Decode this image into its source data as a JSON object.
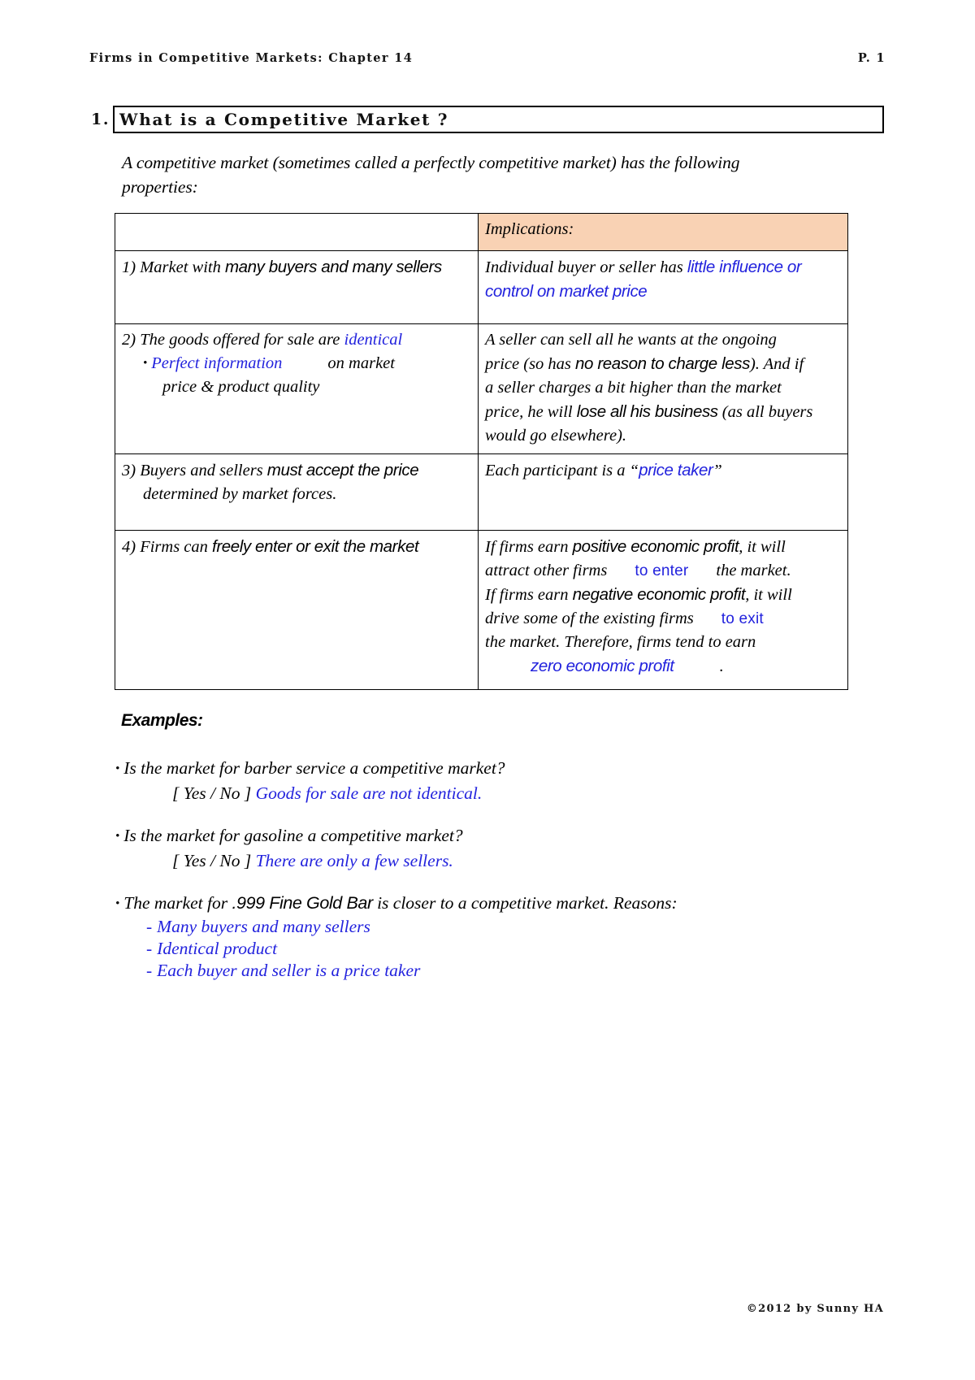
{
  "header": {
    "left_title": "Firms in Competitive Markets: Chapter 14",
    "page_label": "P. 1"
  },
  "footer": {
    "copyright": "©2012 by Sunny HA"
  },
  "section": {
    "number": "1.",
    "title": "What is a Competitive Market ?"
  },
  "intro": {
    "text": "A competitive market (sometimes called a perfectly competitive market) has the following properties:"
  },
  "table": {
    "header_left": "",
    "header_right": "Implications:",
    "rows": [
      {
        "left_num": "1)",
        "left_a": "Market with ",
        "left_b": "many buyers and many sellers",
        "right_a": "Individual buyer or seller has ",
        "right_blue": "little influence or control on market price"
      },
      {
        "left_num": "2)",
        "left_a": "The goods offered for sale are ",
        "left_blue": "identical",
        "bullet_blue": "Perfect information",
        "bullet_rest_1": "on market",
        "bullet_rest_2": "price & product quality",
        "right_1a": "A seller can sell all he wants at the ongoing",
        "right_2a": "price (so has ",
        "right_2b": "no reason to charge less",
        "right_2c": "). And if",
        "right_3": "a seller charges a bit higher than the market",
        "right_4a": "price, he will ",
        "right_4b": "lose all his business",
        "right_4c": " (as all buyers",
        "right_5": "would go elsewhere)."
      },
      {
        "left_num": "3)",
        "left_a": "Buyers and sellers ",
        "left_b": "must accept the price",
        "left_line2": "determined by market forces.",
        "right_a": "Each participant is a ",
        "right_quote_open": "“",
        "right_blue": "price taker",
        "right_quote_close": "”"
      },
      {
        "left_num": "4)",
        "left_a": "Firms can ",
        "left_b": "freely enter or exit the market",
        "right_1a": "If firms earn ",
        "right_1b": "positive economic profit",
        "right_1c": ", it will",
        "right_2a": "attract other firms",
        "right_2blue": "to enter",
        "right_2b": "the market.",
        "right_3a": "If firms earn ",
        "right_3b": "negative economic profit",
        "right_3c": ", it will",
        "right_4a": "drive some of the existing firms",
        "right_4blue": "to exit",
        "right_5a": "the market. Therefore, firms tend to earn",
        "right_6blue": "zero economic profit",
        "right_6end": "."
      }
    ]
  },
  "examples": {
    "heading": "Examples:",
    "items": [
      {
        "bullet": "•",
        "question": "Is the market for barber service a competitive market?",
        "choice": "[ Yes / No ]",
        "answer_blue": "Goods for sale are not identical."
      },
      {
        "bullet": "•",
        "question": "Is the market for gasoline a competitive market?",
        "choice": "[ Yes / No ]",
        "answer_blue": "There are only a few sellers."
      },
      {
        "bullet": "•",
        "lead_a": "The market for ",
        "lead_b": ".999 Fine Gold Bar",
        "lead_c": " is closer to a competitive market.  Reasons:",
        "reasons": [
          "Many buyers and many sellers",
          "Identical product",
          "Each buyer and seller is a price taker"
        ],
        "dash": "-"
      }
    ]
  },
  "colors": {
    "blue": "#2222dd",
    "header_fill": "#f9d2b4",
    "text": "#000000"
  }
}
